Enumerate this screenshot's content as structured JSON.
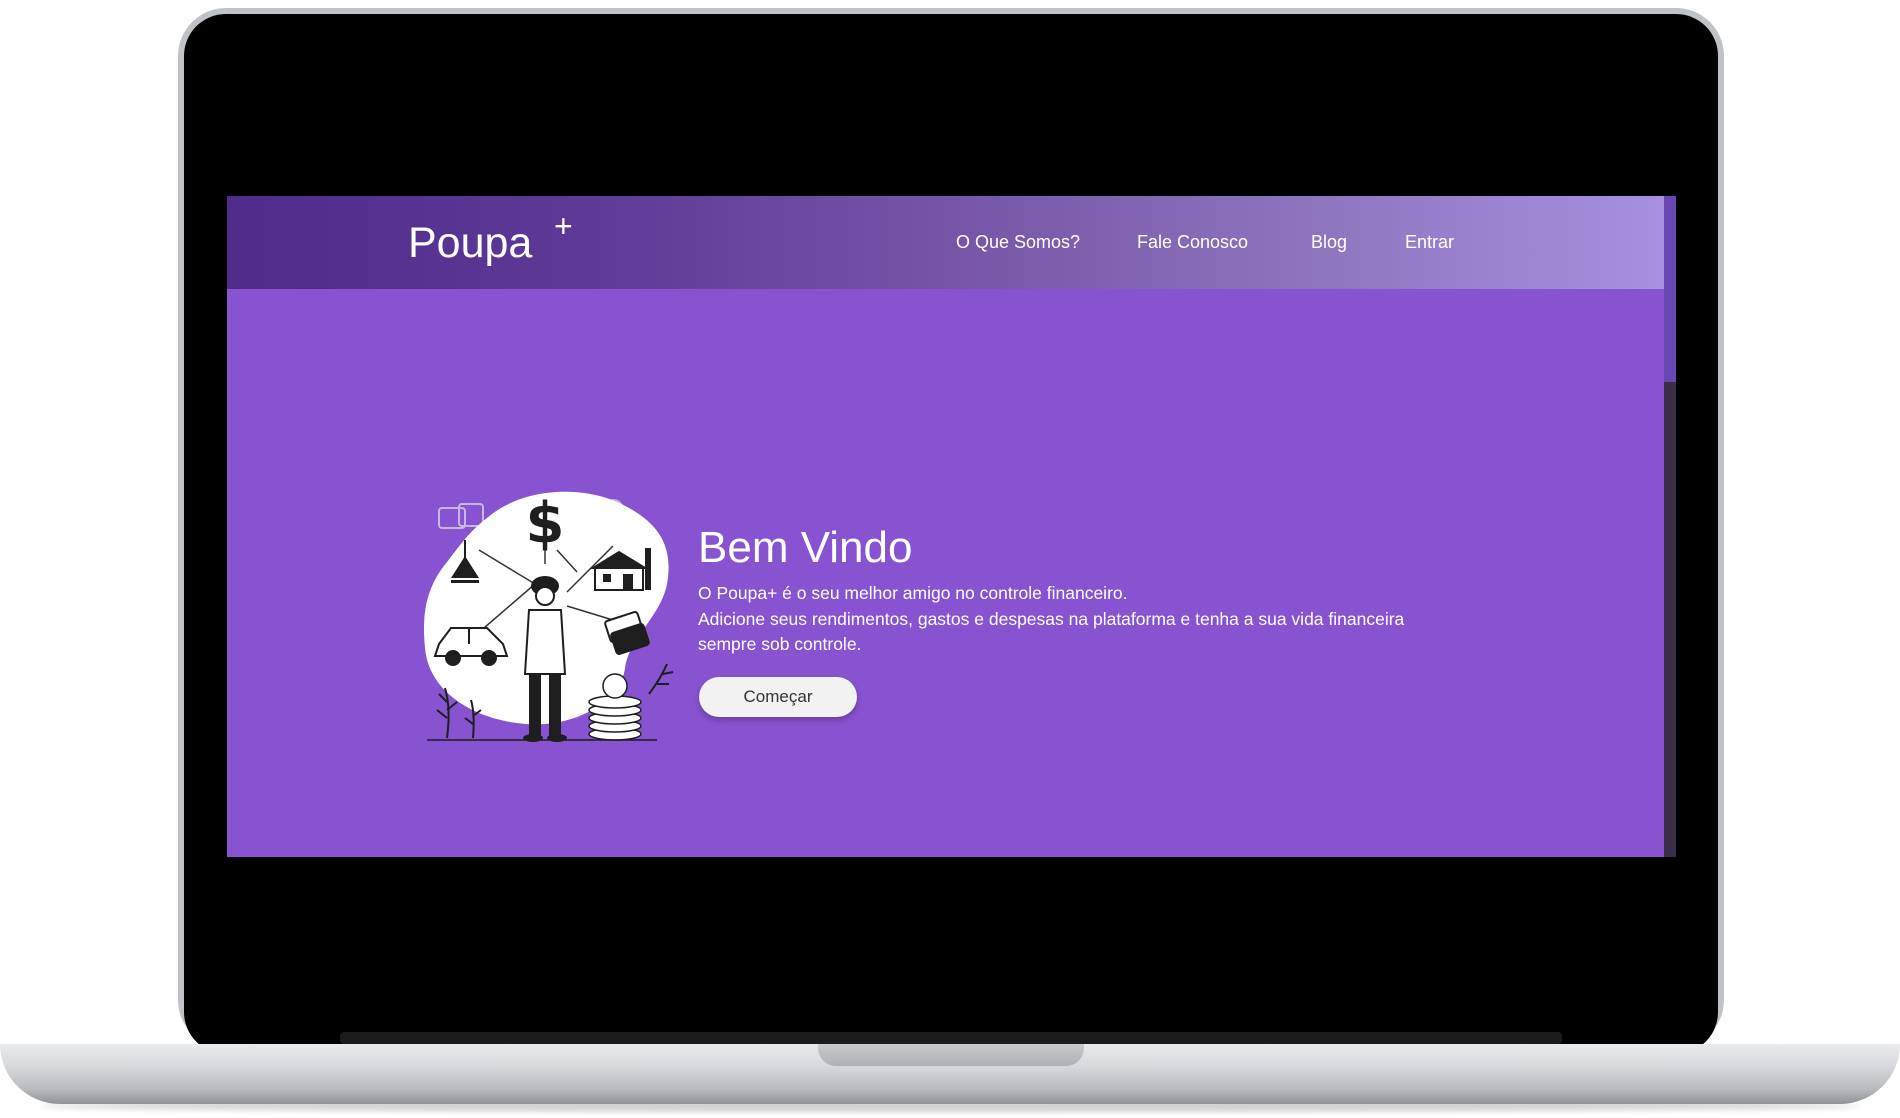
{
  "brand": {
    "name": "Poupa",
    "superscript": "+"
  },
  "nav": {
    "items": [
      "O Que Somos?",
      "Fale Conosco",
      "Blog",
      "Entrar"
    ]
  },
  "hero": {
    "title": "Bem Vindo",
    "lines": [
      "O Poupa+ é o seu melhor amigo no controle financeiro.",
      "Adicione seus rendimentos, gastos e despesas na plataforma e tenha a sua vida financeira",
      "sempre sob controle."
    ],
    "cta_label": "Começar"
  },
  "colors": {
    "background": "#8753d0",
    "header_gradient_start": "#4f2b8a",
    "header_gradient_end": "#a690e0",
    "button_bg": "#f2f2f2"
  }
}
